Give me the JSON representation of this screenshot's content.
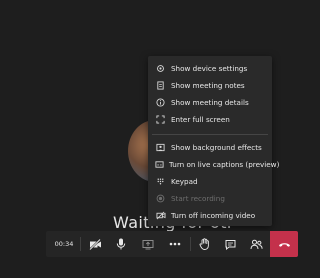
{
  "stage": {
    "waiting_text": "Waiting for others to join..."
  },
  "more_menu": {
    "items": [
      {
        "label": "Show device settings",
        "icon": "gear-icon",
        "enabled": true
      },
      {
        "label": "Show meeting notes",
        "icon": "notes-icon",
        "enabled": true
      },
      {
        "label": "Show meeting details",
        "icon": "info-icon",
        "enabled": true
      },
      {
        "label": "Enter full screen",
        "icon": "fullscreen-icon",
        "enabled": true
      },
      {
        "label": "Show background effects",
        "icon": "background-effects-icon",
        "enabled": true
      },
      {
        "label": "Turn on live captions (preview)",
        "icon": "captions-icon",
        "enabled": true
      },
      {
        "label": "Keypad",
        "icon": "keypad-icon",
        "enabled": true
      },
      {
        "label": "Start recording",
        "icon": "record-icon",
        "enabled": false
      },
      {
        "label": "Turn off incoming video",
        "icon": "video-off-icon",
        "enabled": true
      }
    ]
  },
  "toolbar": {
    "timer": "00:34",
    "buttons": [
      "camera-off-icon",
      "microphone-icon",
      "share-screen-icon",
      "more-options-icon",
      "raise-hand-icon",
      "chat-icon",
      "participants-icon",
      "hang-up-icon"
    ]
  },
  "colors": {
    "background": "#1e1e1e",
    "menu_background": "#2a2a2a",
    "toolbar_background": "#252525",
    "hang_up": "#c4314b"
  }
}
